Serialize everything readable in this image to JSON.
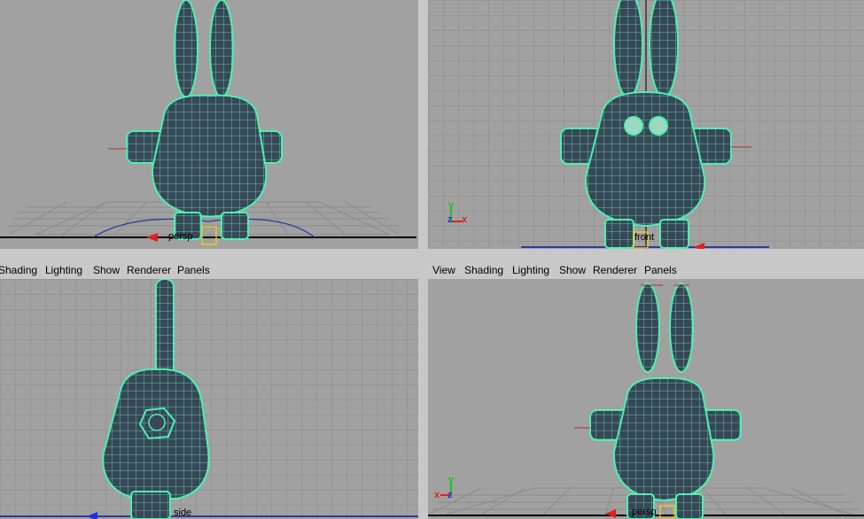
{
  "menu_items": [
    "View",
    "Shading",
    "Lighting",
    "Show",
    "Renderer",
    "Panels"
  ],
  "viewports": {
    "persp": {
      "camera": "persp"
    },
    "front": {
      "camera": "front",
      "axes": {
        "up": "y",
        "left": "z",
        "right": "x"
      }
    },
    "side": {
      "camera": "side"
    },
    "persp2": {
      "camera": "persp",
      "axes": {
        "up": "y",
        "left": "x",
        "right": "z"
      }
    }
  },
  "colors": {
    "viewport_bg": "#a1a1a1",
    "grid": "#8a8a8a",
    "wire": "#4ef0b0",
    "mesh_fill": "#3a4658",
    "axis_x": "#e02020",
    "axis_y": "#20c020",
    "axis_z": "#2030e0"
  }
}
